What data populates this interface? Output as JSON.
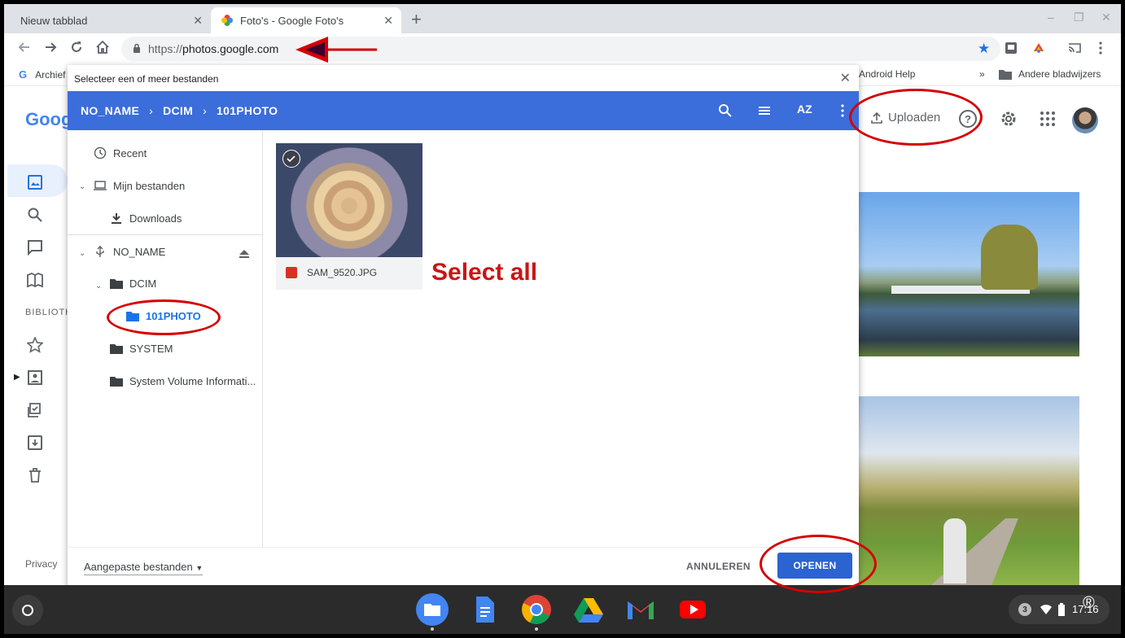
{
  "browser": {
    "tabs": [
      {
        "label": "Nieuw tabblad",
        "active": false
      },
      {
        "label": "Foto's - Google Foto's",
        "active": true
      }
    ],
    "new_tab": "+",
    "window_controls": {
      "minimize": "‒",
      "restore": "❐",
      "close": "✕"
    },
    "url_scheme": "https://",
    "url_host": "photos.google.com",
    "bookmarks": [
      {
        "label": "Archief",
        "icon": "google-icon"
      },
      {
        "label": "Android Help",
        "icon": "none"
      },
      {
        "label": "»",
        "icon": "none"
      },
      {
        "label": "Andere bladwijzers",
        "icon": "folder-icon"
      }
    ]
  },
  "photos_page": {
    "logo": "Goog",
    "upload_label": "Uploaden",
    "library_heading": "BIBLIOTH",
    "privacy_label": "Privacy"
  },
  "dialog": {
    "title": "Selecteer een of meer bestanden",
    "close": "✕",
    "breadcrumb": [
      "NO_NAME",
      "DCIM",
      "101PHOTO"
    ],
    "breadcrumb_sep": "›",
    "sort_label": "AZ",
    "sidebar": {
      "recent": "Recent",
      "my_files": "Mijn bestanden",
      "downloads": "Downloads",
      "usb": "NO_NAME",
      "dcim": "DCIM",
      "photo_folder": "101PHOTO",
      "system": "SYSTEM",
      "svi": "System Volume Informati..."
    },
    "file": {
      "name": "SAM_9520.JPG"
    },
    "annotation": "Select all",
    "file_type": "Aangepaste bestanden",
    "cancel": "ANNULEREN",
    "open": "OPENEN"
  },
  "shelf": {
    "apps": [
      "files-icon",
      "docs-icon",
      "chrome-icon",
      "drive-icon",
      "gmail-icon",
      "youtube-icon"
    ],
    "notification_count": "3",
    "time": "17:16",
    "watermark": "®"
  },
  "colors": {
    "dialog_header": "#3b6ddb",
    "open_button": "#2b63d1",
    "annotation_red": "#cc1414",
    "active_blue": "#1a73e8"
  }
}
